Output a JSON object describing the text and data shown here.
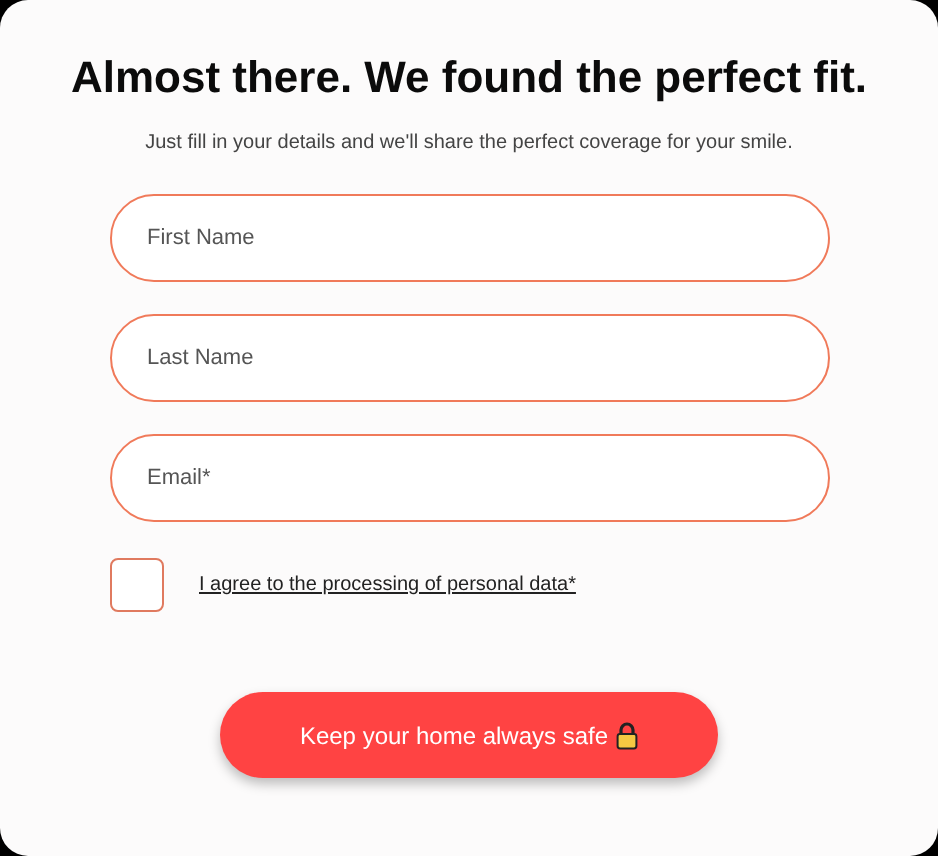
{
  "title": "Almost there. We found the perfect fit.",
  "subtitle": "Just fill in your details and we'll share the perfect coverage for your smile.",
  "fields": [
    {
      "placeholder": "First Name"
    },
    {
      "placeholder": "Last Name"
    },
    {
      "placeholder": "Email*"
    }
  ],
  "consent": {
    "label": "I agree to the processing of personal data*",
    "checked": false
  },
  "submit": {
    "label": "Keep your home always safe"
  }
}
